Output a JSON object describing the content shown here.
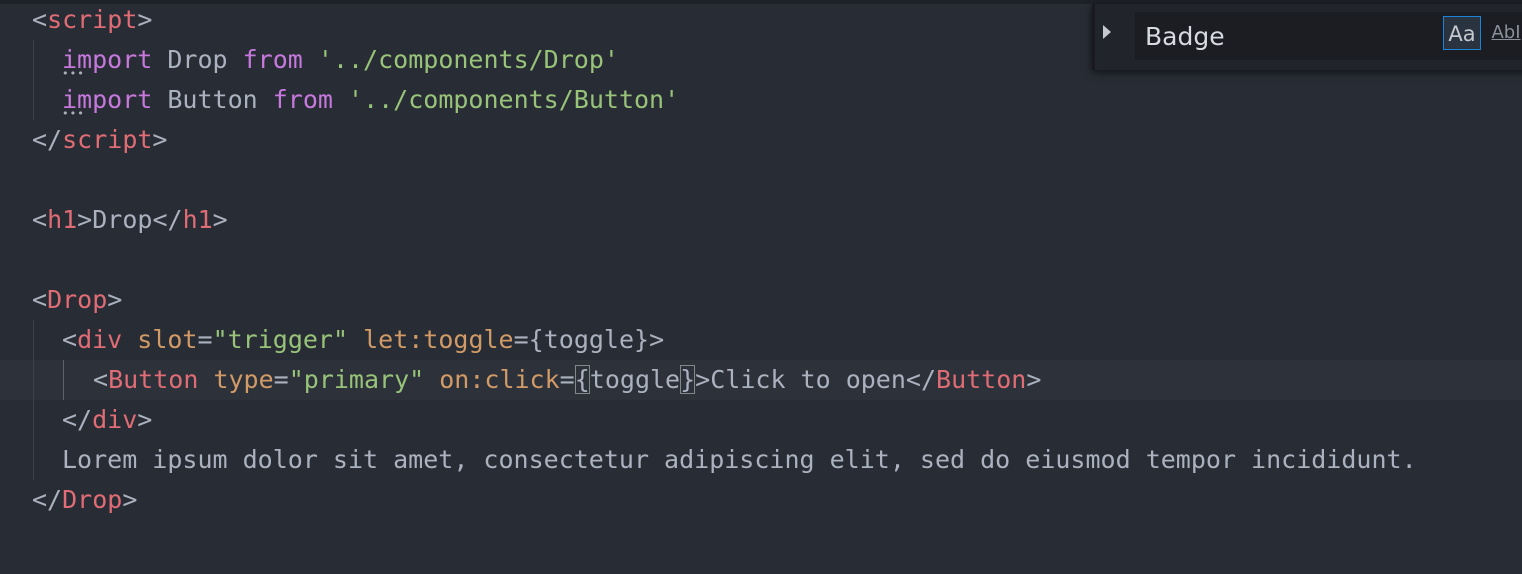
{
  "editor": {
    "lines": {
      "l1": {
        "open": "<",
        "tag": "script",
        "close": ">"
      },
      "l2": {
        "kw1": "import",
        "name": " Drop ",
        "kw2": "from",
        "str": "'../components/Drop'"
      },
      "l3": {
        "kw1": "import",
        "name": " Button ",
        "kw2": "from",
        "str": "'../components/Button'"
      },
      "l4": {
        "open": "</",
        "tag": "script",
        "close": ">"
      },
      "l6": {
        "open1": "<",
        "tag1": "h1",
        "close1": ">",
        "text": "Drop",
        "open2": "</",
        "tag2": "h1",
        "close2": ">"
      },
      "l8": {
        "open": "<",
        "tag": "Drop",
        "close": ">"
      },
      "l9": {
        "open": "<",
        "tag": "div",
        "attr1": "slot",
        "eq1": "=",
        "str1": "\"trigger\"",
        "attr2": "let:toggle",
        "eq2": "=",
        "expr": "{toggle}",
        "close": ">"
      },
      "l10": {
        "open": "<",
        "tag": "Button",
        "attr1": "type",
        "eq1": "=",
        "str1": "\"primary\"",
        "attr2": "on:click",
        "eq2": "=",
        "lbrace": "{",
        "expr": "toggle",
        "rbrace": "}",
        "gt": ">",
        "text": "Click to open",
        "open2": "</",
        "tag2": "Button",
        "close2": ">"
      },
      "l11": {
        "open": "</",
        "tag": "div",
        "close": ">"
      },
      "l12": {
        "text": "Lorem ipsum dolor sit amet, consectetur adipiscing elit, sed do eiusmod tempor incididunt."
      },
      "l13": {
        "open": "</",
        "tag": "Drop",
        "close": ">"
      }
    },
    "colors": {
      "background": "#282c34",
      "tag": "#e06c75",
      "attribute": "#d19a66",
      "string": "#98c379",
      "keyword": "#c678dd",
      "text": "#abb2bf"
    }
  },
  "find_widget": {
    "toggle_icon": "chevron-right-icon",
    "search_value": "Badge",
    "match_case_label": "Aa",
    "whole_word_label": "AbI"
  }
}
